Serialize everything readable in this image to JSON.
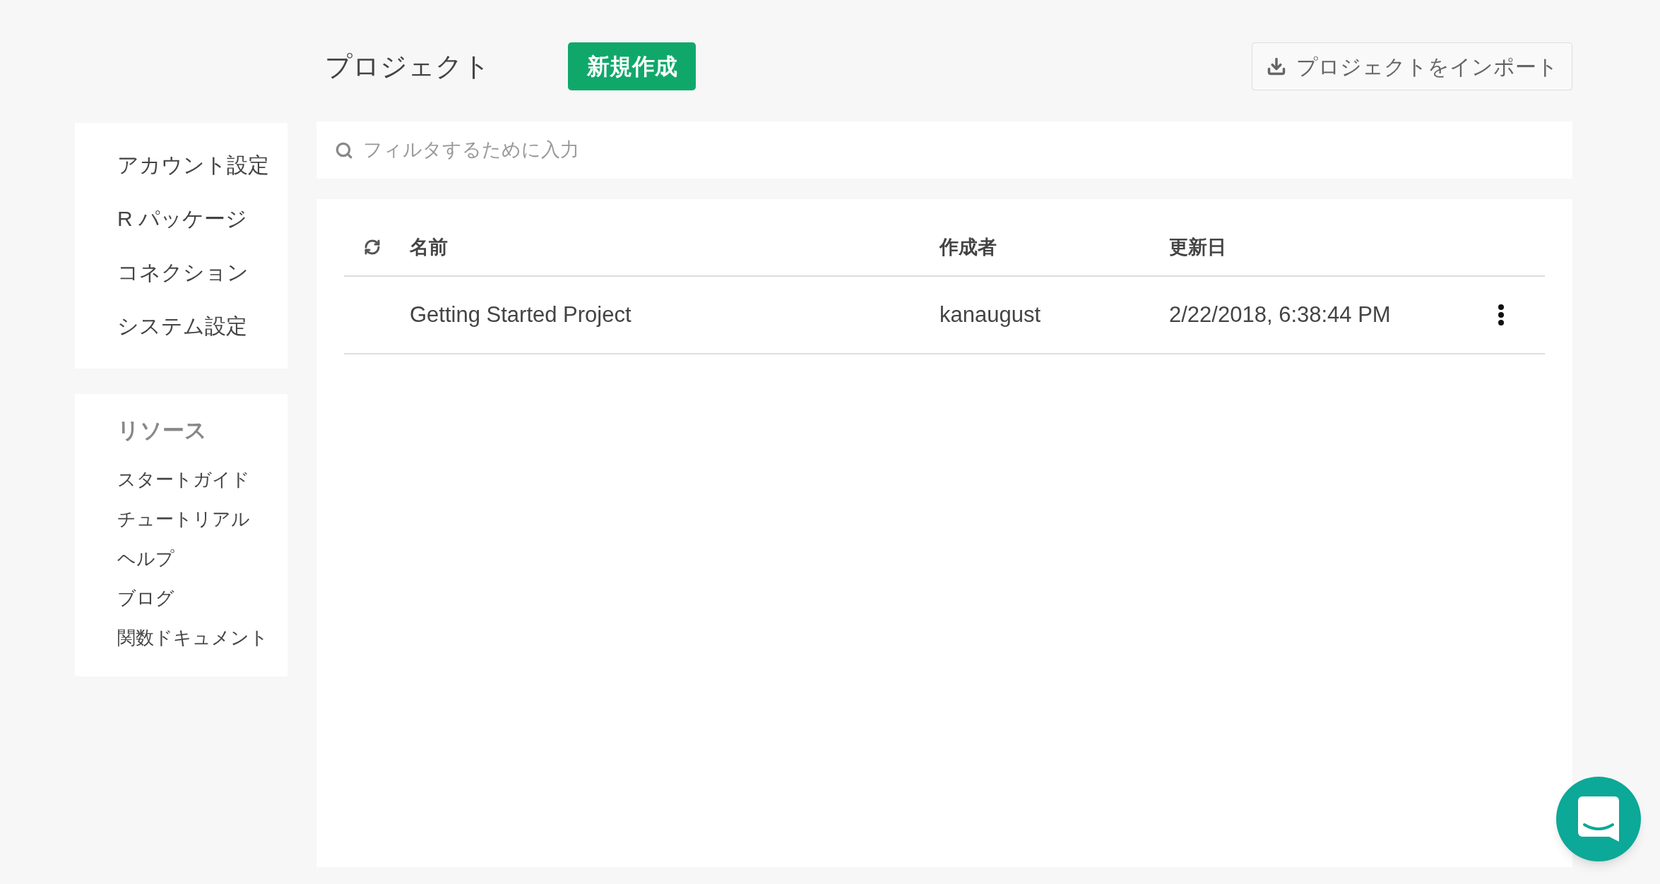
{
  "header": {
    "title": "プロジェクト",
    "new_button": "新規作成",
    "import_button": "プロジェクトをインポート"
  },
  "sidebar": {
    "settings": [
      "アカウント設定",
      "R パッケージ",
      "コネクション",
      "システム設定"
    ],
    "resources": {
      "title": "リソース",
      "items": [
        "スタートガイド",
        "チュートリアル",
        "ヘルプ",
        "ブログ",
        "関数ドキュメント"
      ]
    }
  },
  "search": {
    "placeholder": "フィルタするために入力"
  },
  "table": {
    "columns": [
      "名前",
      "作成者",
      "更新日"
    ],
    "rows": [
      {
        "name": "Getting Started Project",
        "author": "kanaugust",
        "updated": "2/22/2018, 6:38:44 PM"
      }
    ]
  }
}
